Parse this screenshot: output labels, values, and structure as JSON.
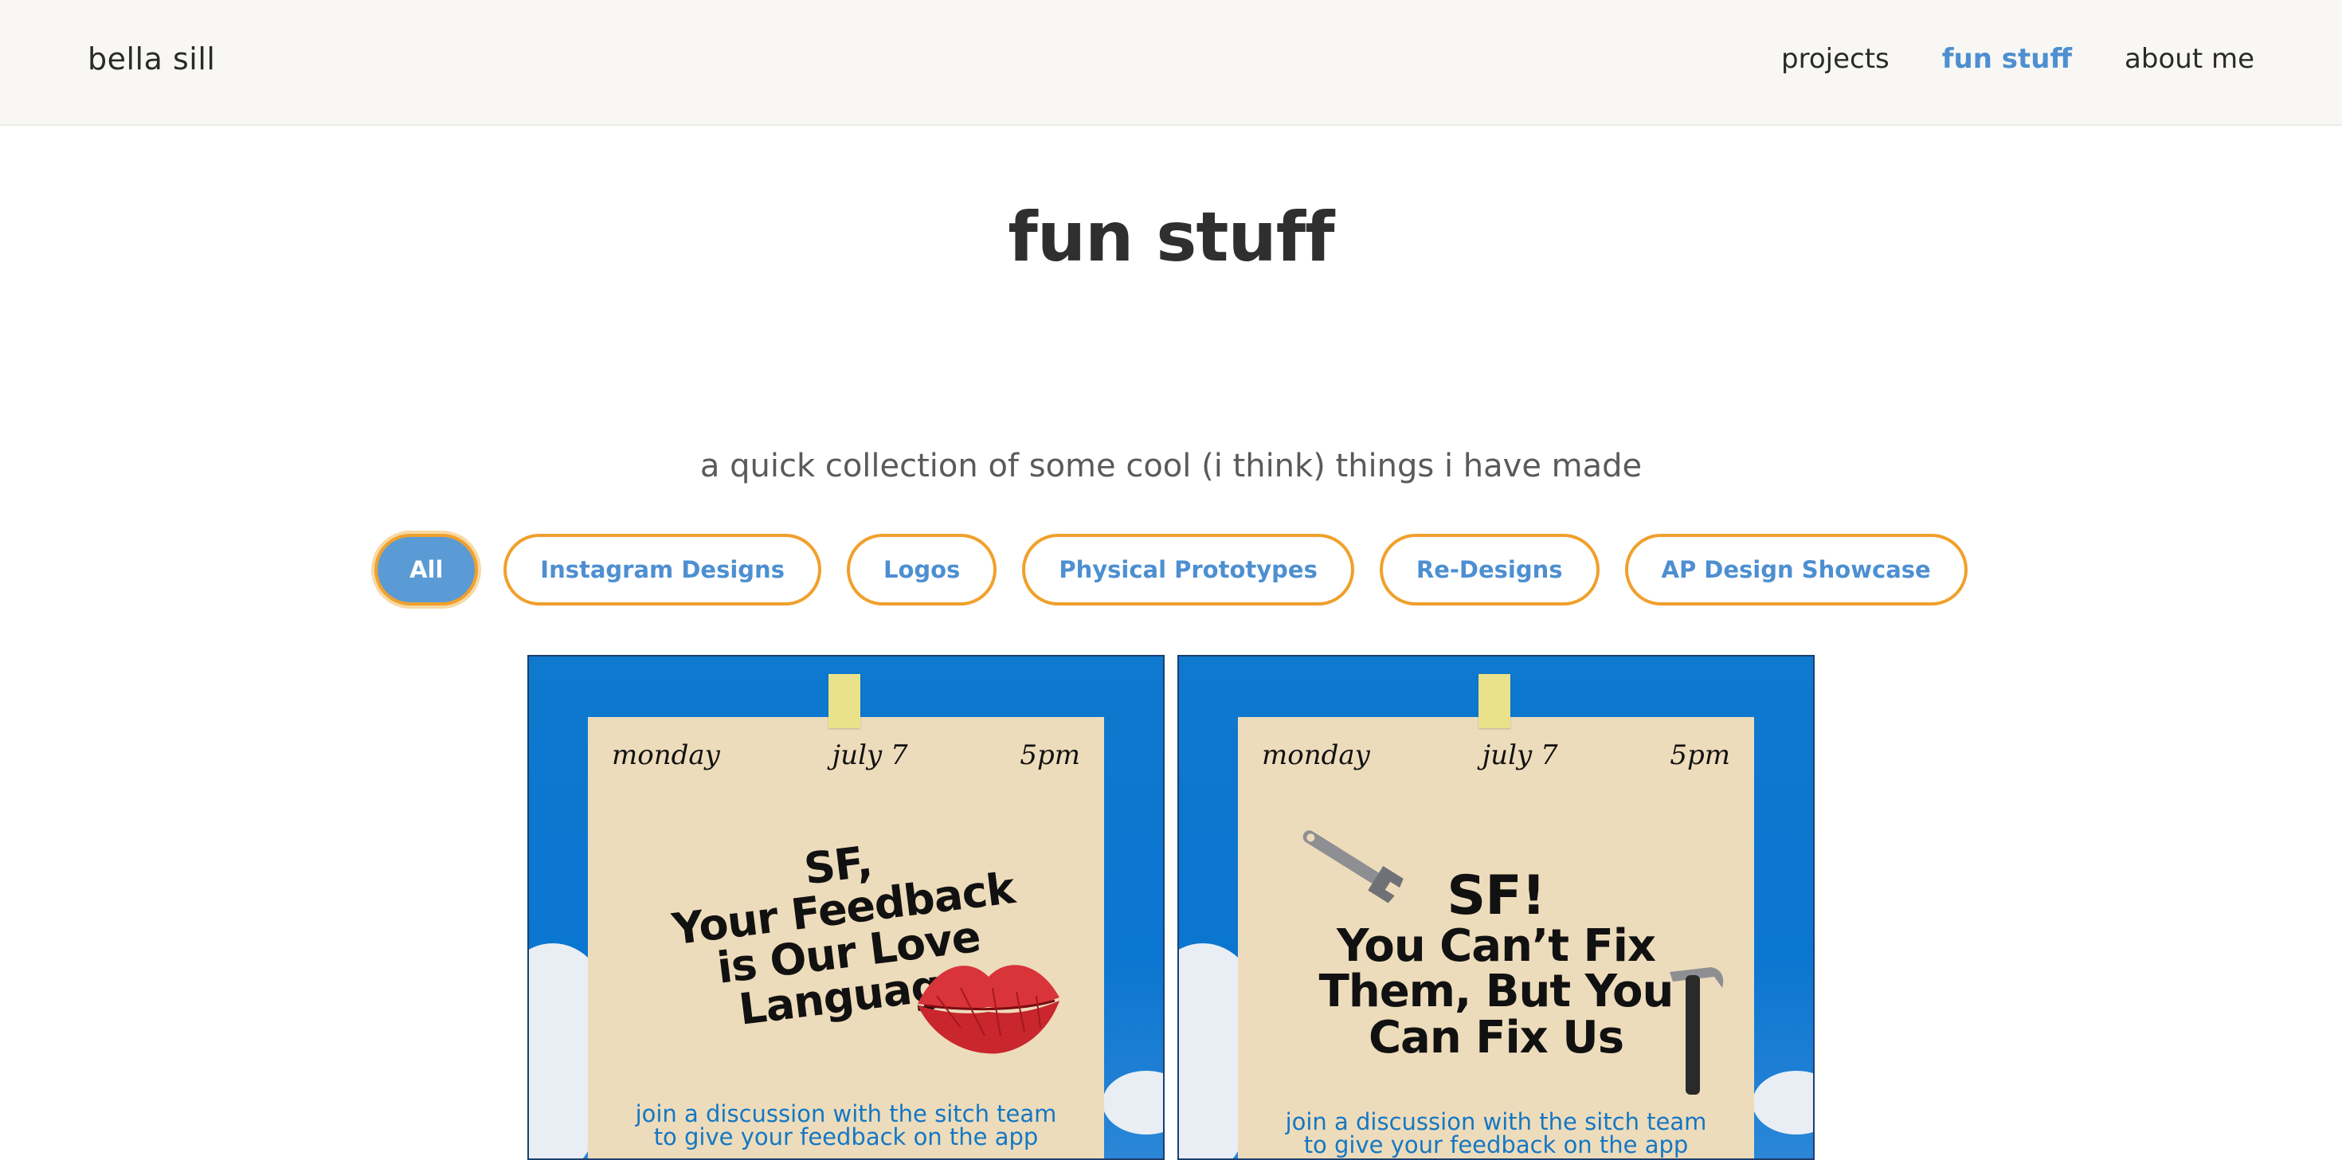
{
  "header": {
    "brand": "bella sill",
    "nav": [
      {
        "label": "projects",
        "active": false
      },
      {
        "label": "fun stuff",
        "active": true
      },
      {
        "label": "about me",
        "active": false
      }
    ]
  },
  "page": {
    "title": "fun stuff",
    "tagline": "a quick collection of some cool (i think) things i have made"
  },
  "filters": [
    {
      "label": "All",
      "active": true
    },
    {
      "label": "Instagram Designs",
      "active": false
    },
    {
      "label": "Logos",
      "active": false
    },
    {
      "label": "Physical Prototypes",
      "active": false
    },
    {
      "label": "Re-Designs",
      "active": false
    },
    {
      "label": "AP Design Showcase",
      "active": false
    }
  ],
  "cards": [
    {
      "day": "monday",
      "date": "july 7",
      "time": "5pm",
      "headline": [
        "SF,",
        "Your Feedback",
        "is Our Love",
        "Language"
      ],
      "footer": [
        "join a discussion with the sitch team",
        "to give your feedback on the app"
      ]
    },
    {
      "day": "monday",
      "date": "july 7",
      "time": "5pm",
      "headline": [
        "SF!",
        "You Can’t Fix",
        "Them, But You",
        "Can Fix Us"
      ],
      "footer": [
        "join a discussion with the sitch team",
        "to give your feedback on the app"
      ]
    }
  ],
  "colors": {
    "accent": "#4d8fd1",
    "pill_border": "#f0a02c",
    "poster_bg": "#eddcbb",
    "sky": "#0b76d0"
  }
}
